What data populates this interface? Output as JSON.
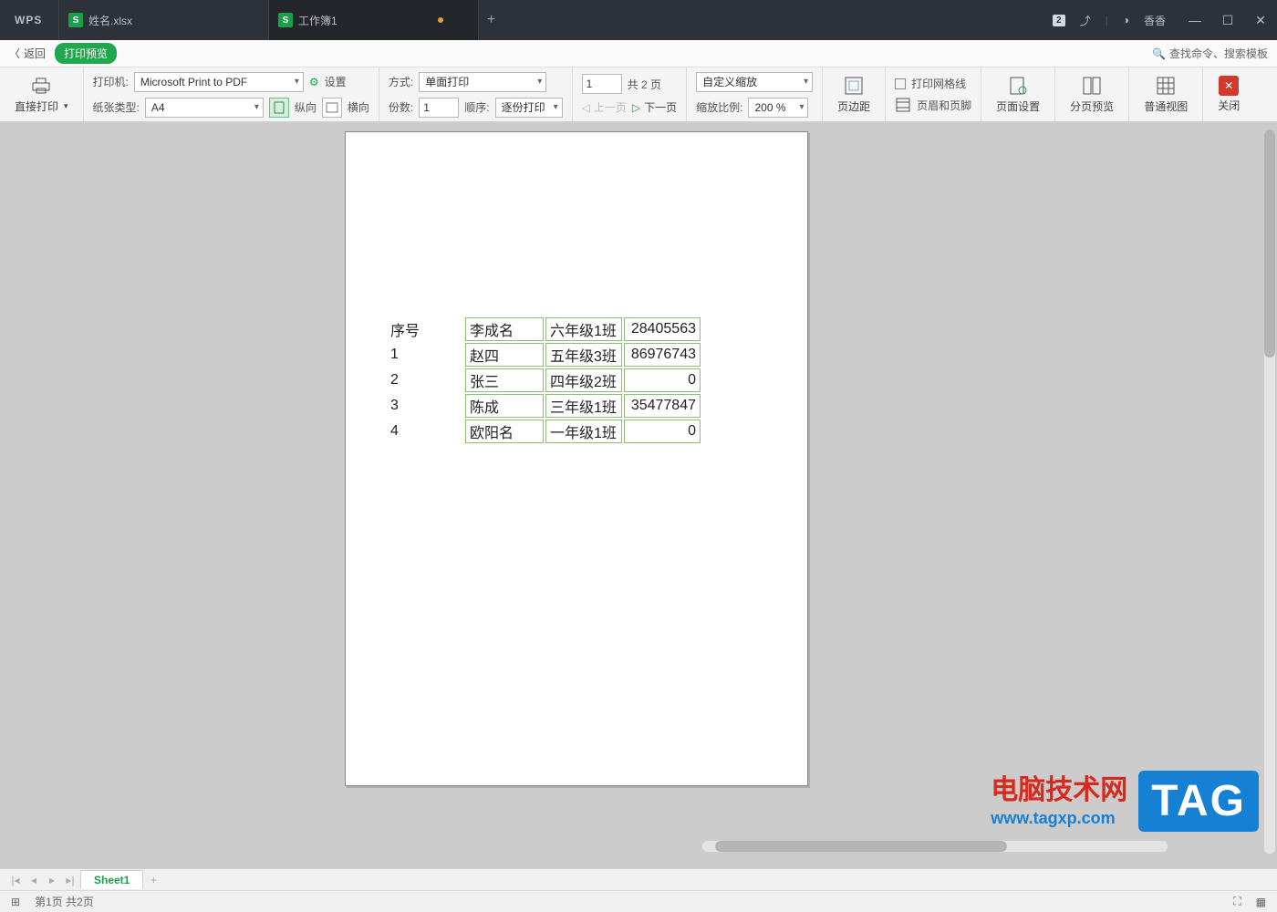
{
  "app_name": "WPS",
  "tabs": [
    {
      "label": "姓名.xlsx",
      "active": false
    },
    {
      "label": "工作簿1",
      "active": true,
      "dirty": true
    }
  ],
  "user": {
    "name": "香香",
    "badge": "2"
  },
  "ribbon_head": {
    "back": "返回",
    "mode": "打印预览",
    "search_ph": "查找命令、搜索模板"
  },
  "toolbar": {
    "direct_print": "直接打印",
    "printer_lbl": "打印机:",
    "printer_val": "Microsoft Print to PDF",
    "paper_lbl": "纸张类型:",
    "paper_val": "A4",
    "settings": "设置",
    "portrait": "纵向",
    "landscape": "横向",
    "mode_lbl": "方式:",
    "mode_val": "单面打印",
    "copies_lbl": "份数:",
    "copies_val": "1",
    "order_lbl": "顺序:",
    "order_val": "逐份打印",
    "page_val": "1",
    "page_total": "共 2 页",
    "prev": "上一页",
    "next": "下一页",
    "zoom_mode": "自定义缩放",
    "zoom_lbl": "缩放比例:",
    "zoom_val": "200 %",
    "margins": "页边距",
    "gridlines": "打印网格线",
    "headerfooter": "页眉和页脚",
    "pagesetup": "页面设置",
    "pagebreak": "分页预览",
    "normal": "普通视图",
    "close": "关闭"
  },
  "preview": {
    "header": "序号",
    "seq": [
      "1",
      "2",
      "3",
      "4"
    ],
    "rows": [
      {
        "name": "李成名",
        "class": "六年级1班",
        "num": "28405563"
      },
      {
        "name": "赵四",
        "class": "五年级3班",
        "num": "86976743"
      },
      {
        "name": "张三",
        "class": "四年级2班",
        "num": "0"
      },
      {
        "name": "陈成",
        "class": "三年级1班",
        "num": "35477847"
      },
      {
        "name": "欧阳名",
        "class": "一年级1班",
        "num": "0"
      }
    ]
  },
  "sheets": {
    "active": "Sheet1"
  },
  "status": {
    "page": "第1页 共2页"
  },
  "watermark": {
    "title": "电脑技术网",
    "url": "www.tagxp.com",
    "tag": "TAG"
  }
}
